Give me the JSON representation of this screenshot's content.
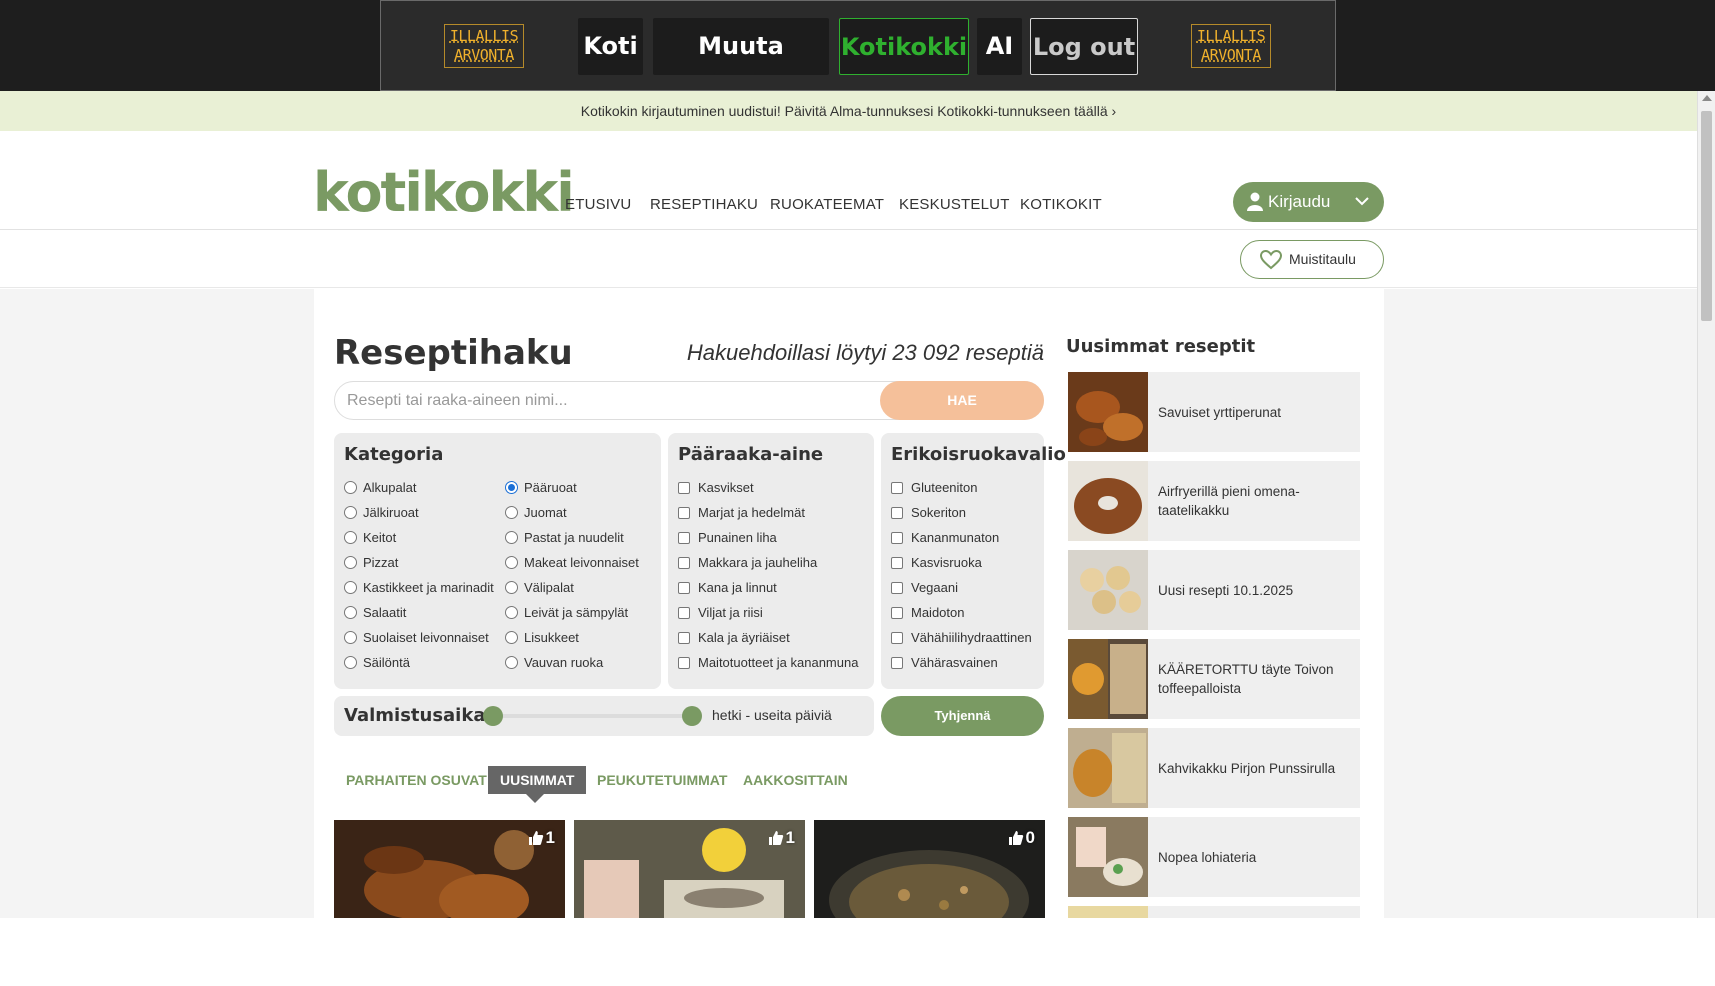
{
  "topbar": {
    "marquee_left": "ILLALLIS ARVONTA",
    "marquee_right": "ILLALLIS ARVONTA",
    "buttons": [
      "Koti",
      "Muuta menua",
      "Kotikokki",
      "AI",
      "Log out"
    ],
    "active": "Kotikokki"
  },
  "announcement": "Kotikokin kirjautuminen uudistui! Päivitä Alma-tunnuksesi Kotikokki-tunnukseen täällä ›",
  "header": {
    "logo": "kotikokki",
    "nav": [
      "ETUSIVU",
      "RESEPTIHAKU",
      "RUOKATEEMAT",
      "KESKUSTELUT",
      "KOTIKOKIT"
    ],
    "login_label": "Kirjaudu",
    "memo_label": "Muistitaulu"
  },
  "search": {
    "title": "Reseptihaku",
    "result_text": "Hakuehdoillasi löytyi 23 092 reseptiä",
    "placeholder": "Resepti tai raaka-aineen nimi...",
    "button": "HAE"
  },
  "filters": {
    "category": {
      "title": "Kategoria",
      "col1": [
        "Alkupalat",
        "Jälkiruoat",
        "Keitot",
        "Pizzat",
        "Kastikkeet ja marinadit",
        "Salaatit",
        "Suolaiset leivonnaiset",
        "Säilöntä"
      ],
      "col2": [
        "Pääruoat",
        "Juomat",
        "Pastat ja nuudelit",
        "Makeat leivonnaiset",
        "Välipalat",
        "Leivät ja sämpylät",
        "Lisukkeet",
        "Vauvan ruoka"
      ],
      "selected": "Pääruoat"
    },
    "main_ingredient": {
      "title": "Pääraaka-aine",
      "items": [
        "Kasvikset",
        "Marjat ja hedelmät",
        "Punainen liha",
        "Makkara ja jauheliha",
        "Kana ja linnut",
        "Viljat ja riisi",
        "Kala ja äyriäiset",
        "Maitotuotteet ja kananmuna"
      ]
    },
    "special_diet": {
      "title": "Erikoisruokavalio",
      "items": [
        "Gluteeniton",
        "Sokeriton",
        "Kananmunaton",
        "Kasvisruoka",
        "Vegaani",
        "Maidoton",
        "Vähähiilihydraattinen",
        "Vähärasvainen"
      ]
    },
    "time": {
      "label": "Valmistusaika",
      "range": "hetki - useita päiviä"
    },
    "clear": "Tyhjennä"
  },
  "sort_tabs": [
    "PARHAITEN OSUVAT",
    "UUSIMMAT",
    "PEUKUTETUIMMAT",
    "AAKKOSITTAIN"
  ],
  "sort_active": "UUSIMMAT",
  "cards": [
    {
      "likes": "1"
    },
    {
      "likes": "1"
    },
    {
      "likes": "0"
    }
  ],
  "sidebar": {
    "title": "Uusimmat reseptit",
    "items": [
      "Savuiset yrttiperunat",
      "Airfryerillä pieni omena-taatelikakku",
      "Uusi resepti 10.1.2025",
      "KÄÄRETORTTU täyte Toivon toffeepalloista",
      "Kahvikakku Pirjon Punssirulla",
      "Nopea lohiateria"
    ]
  },
  "colors": {
    "brand_green": "#7a9a63",
    "search_orange": "#f5c09a",
    "top_active": "#2fb02f",
    "radio_blue": "#1a6fd6"
  }
}
